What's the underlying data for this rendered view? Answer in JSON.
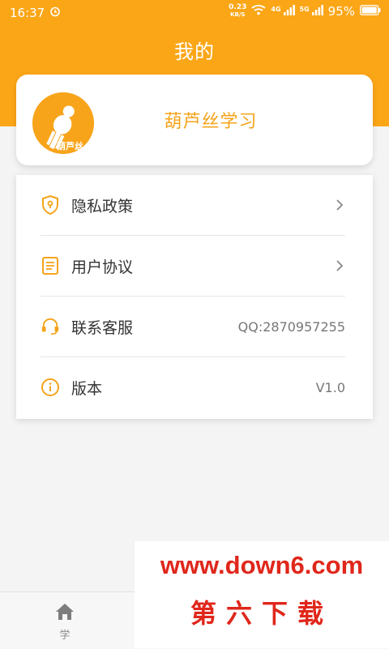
{
  "status_bar": {
    "time": "16:37",
    "net_speed_value": "0.23",
    "net_speed_unit": "KB/S",
    "signal_tag_1": "4G",
    "signal_tag_2": "5G",
    "battery": "95%"
  },
  "header": {
    "title": "我的"
  },
  "profile": {
    "name": "葫芦丝学习",
    "logo_text": "葫芦丝"
  },
  "menu": {
    "items": [
      {
        "label": "隐私政策",
        "icon": "shield-lock-icon",
        "value": ""
      },
      {
        "label": "用户协议",
        "icon": "document-icon",
        "value": ""
      },
      {
        "label": "联系客服",
        "icon": "headset-icon",
        "value": "QQ:2870957255"
      },
      {
        "label": "版本",
        "icon": "info-icon",
        "value": "V1.0"
      }
    ]
  },
  "bottom_nav": {
    "tabs": [
      {
        "label": "学",
        "icon": "home-icon"
      }
    ]
  },
  "watermark": {
    "url": "www.down6.com",
    "name": "第六下载"
  },
  "colors": {
    "accent": "#fba617",
    "watermark": "#e0271b"
  }
}
